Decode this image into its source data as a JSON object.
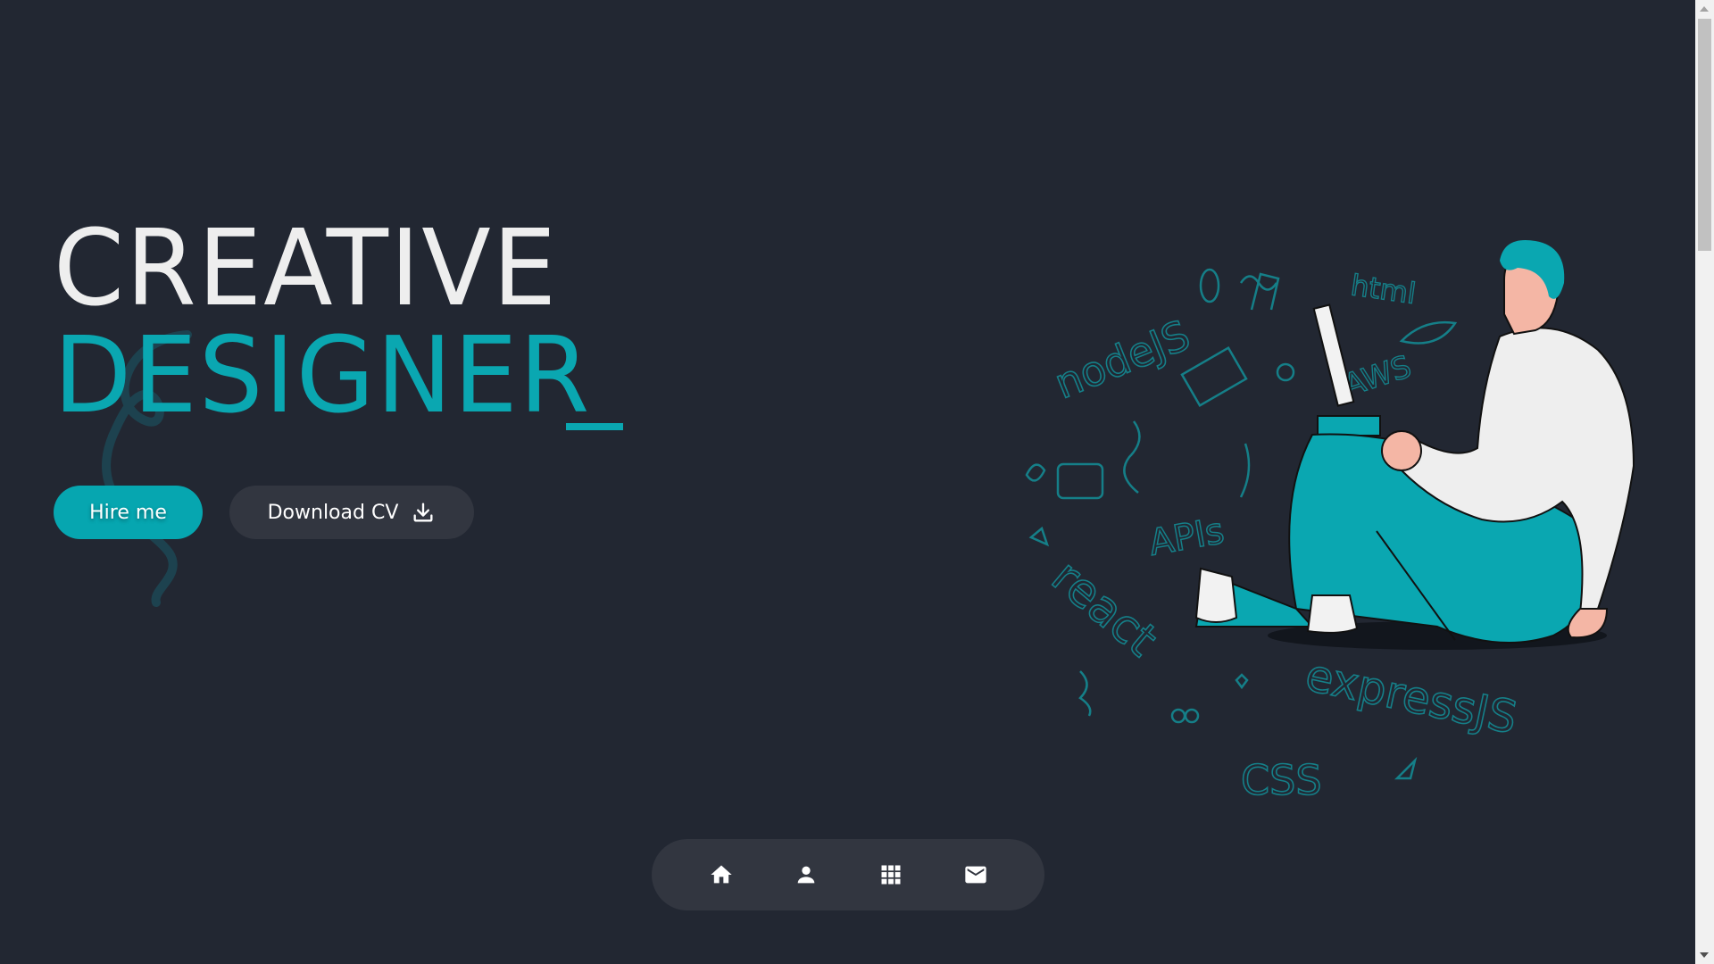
{
  "hero": {
    "title_line1": "CREATIVE",
    "title_line2": "DESIGNER"
  },
  "buttons": {
    "hire_label": "Hire me",
    "download_label": "Download CV"
  },
  "illustration": {
    "doodles": [
      "nodeJS",
      "html",
      "AWS",
      "APIs",
      "react",
      "expressJS",
      "CSS"
    ]
  },
  "nav": {
    "items": [
      {
        "icon": "home-icon"
      },
      {
        "icon": "user-icon"
      },
      {
        "icon": "grid-icon"
      },
      {
        "icon": "mail-icon"
      }
    ]
  },
  "colors": {
    "background": "#222732",
    "accent": "#0aa7b1",
    "surface": "#323640",
    "text": "#eeeeee"
  }
}
